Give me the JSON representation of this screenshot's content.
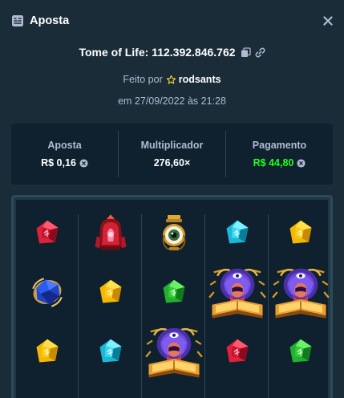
{
  "header": {
    "title": "Aposta",
    "icon": "bet-slip-icon",
    "close_icon": "close-icon"
  },
  "game": {
    "title": "Tome of Life: 112.392.846.762",
    "copy_icon": "copy-icon",
    "link_icon": "link-icon"
  },
  "author": {
    "prefix": "Feito por",
    "username": "rodsants",
    "icon": "star-icon"
  },
  "date": "em 27/09/2022 às 21:28",
  "stats": {
    "bet_label": "Aposta",
    "bet_value": "R$ 0,16",
    "multiplier_label": "Multiplicador",
    "multiplier_value": "276,60×",
    "payout_label": "Pagamento",
    "payout_value": "R$ 44,80",
    "currency_icon": "currency-coin-icon"
  },
  "colors": {
    "background": "#1a2c38",
    "panel": "#0f212e",
    "payout_green": "#1fff20",
    "text_muted": "#b1bad3"
  },
  "reels": [
    [
      "red-gem",
      "blue-sapphire",
      "yellow-gem"
    ],
    [
      "red-amulet",
      "yellow-gem",
      "cyan-gem"
    ],
    [
      "golden-eye-lantern",
      "green-gem",
      "wizard-book"
    ],
    [
      "cyan-gem",
      "wizard-book",
      "red-gem"
    ],
    [
      "yellow-gem",
      "wizard-book",
      "green-gem"
    ]
  ]
}
